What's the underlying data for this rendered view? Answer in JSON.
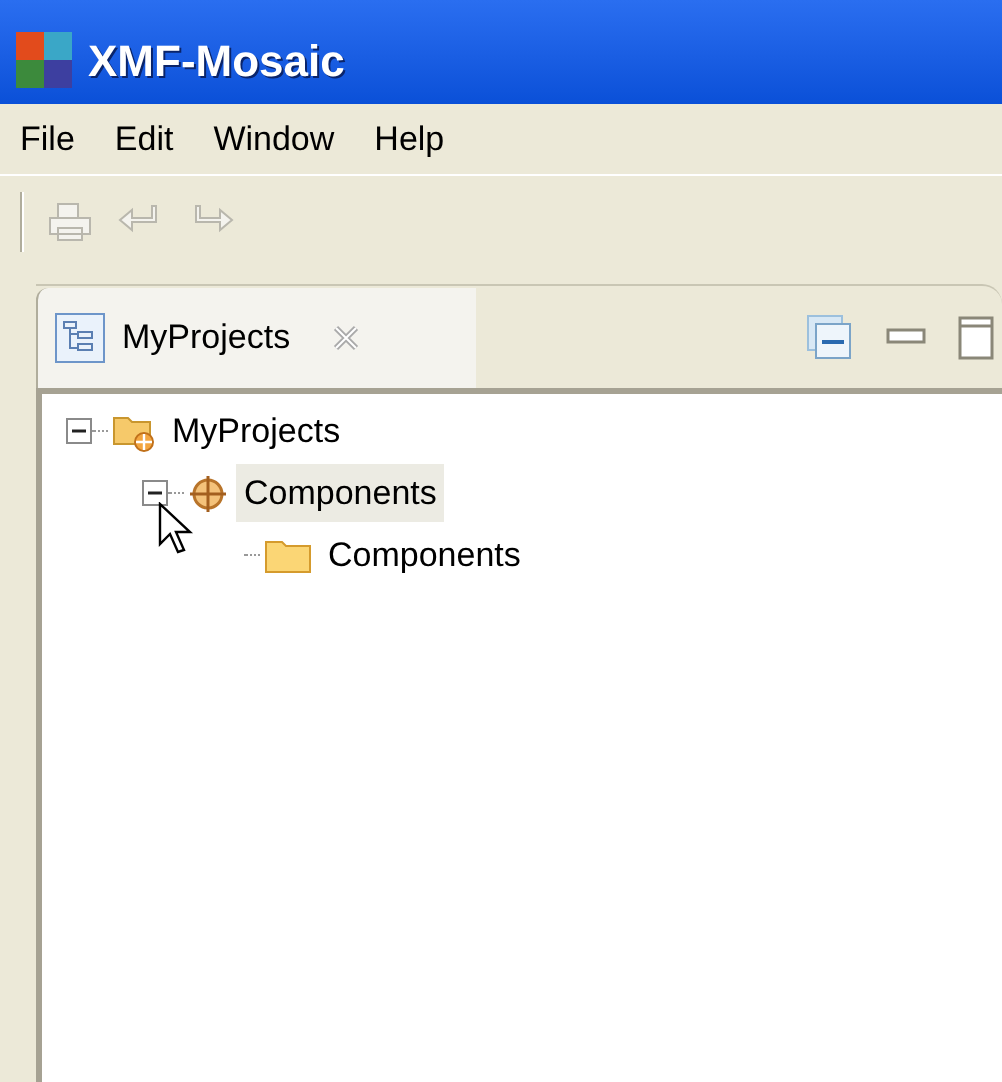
{
  "window": {
    "title": "XMF-Mosaic"
  },
  "menu": [
    "File",
    "Edit",
    "Window",
    "Help"
  ],
  "view": {
    "tab": {
      "label": "MyProjects",
      "selected": true
    },
    "tree": [
      {
        "label": "MyProjects",
        "kind": "project",
        "expanded": true,
        "selected": false,
        "children": [
          {
            "label": "Components",
            "kind": "component",
            "expanded": true,
            "selected": true,
            "children": [
              {
                "label": "Components",
                "kind": "folder",
                "selected": false
              }
            ]
          }
        ]
      }
    ]
  }
}
